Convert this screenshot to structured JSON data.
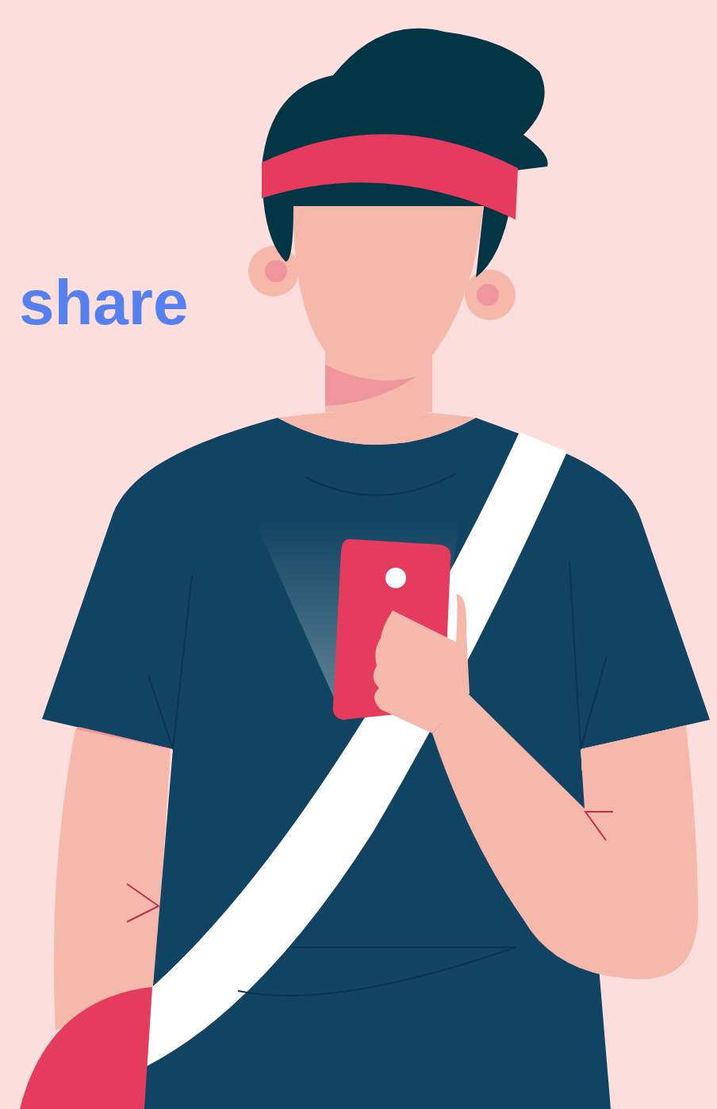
{
  "hero": {
    "heading": "share"
  }
}
